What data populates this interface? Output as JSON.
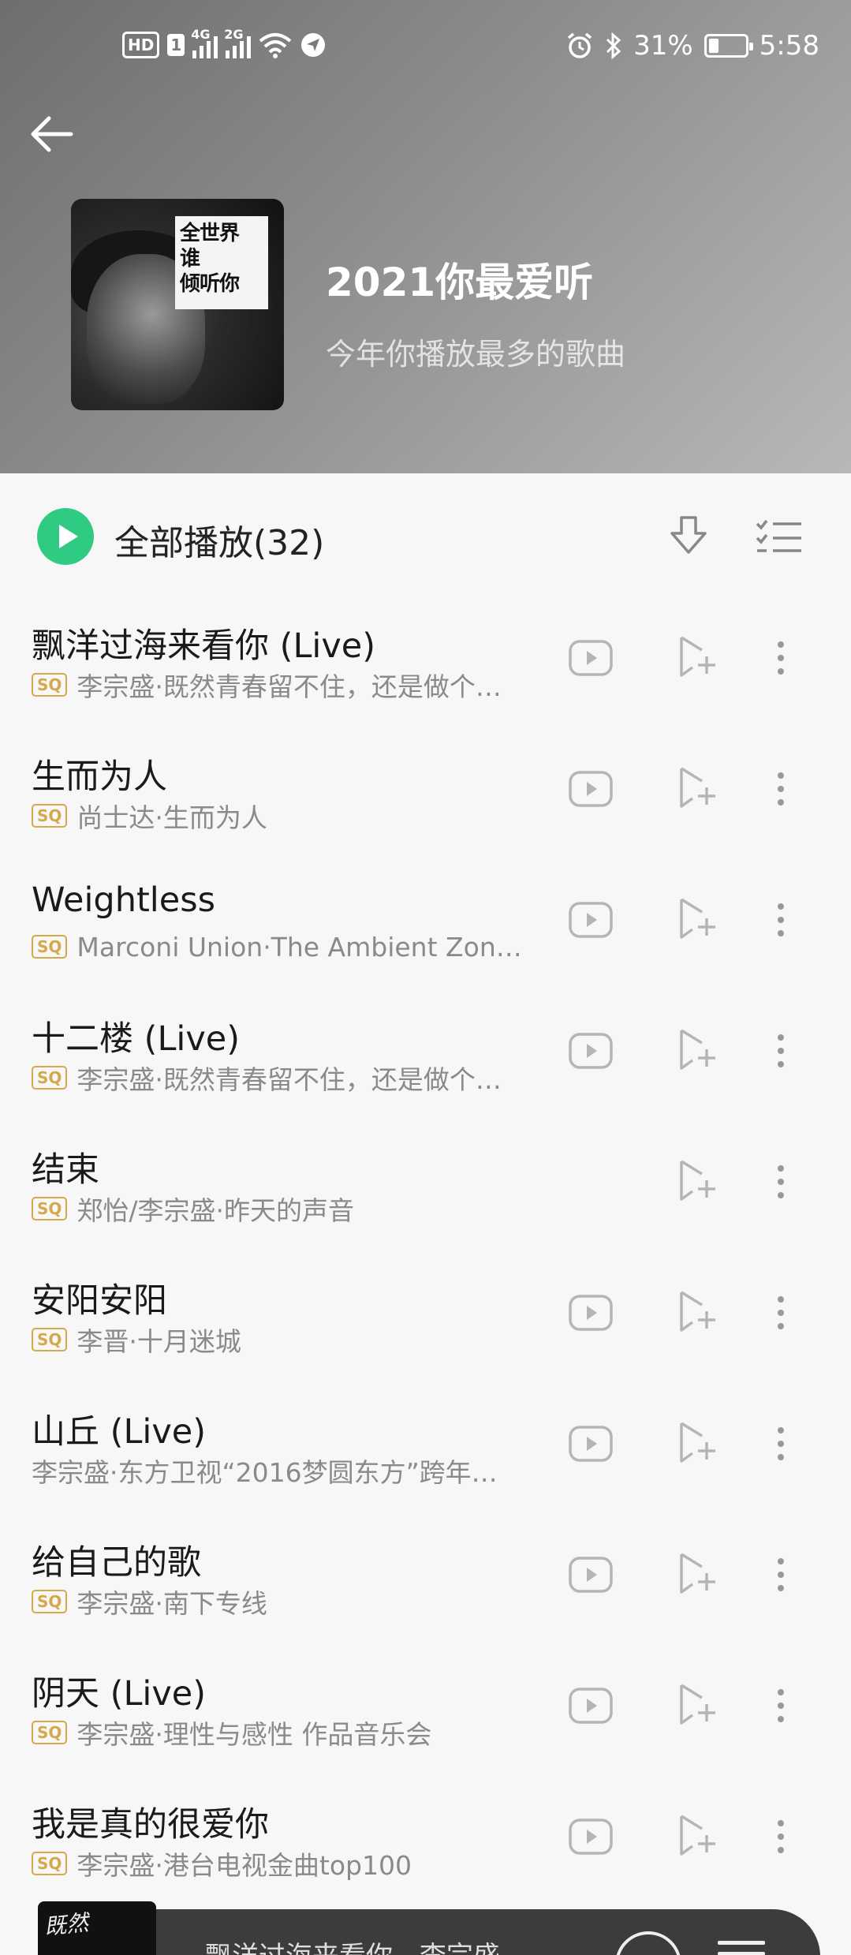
{
  "status_bar": {
    "hd_label": "HD",
    "sim_label": "1",
    "signal1_label": "4G",
    "signal2_label": "2G",
    "battery_percent": "31%",
    "time": "5:58"
  },
  "header": {
    "title": "2021你最爱听",
    "subtitle": "今年你播放最多的歌曲",
    "cover_text": [
      "全世界",
      "谁",
      "倾听你"
    ]
  },
  "toolbar": {
    "play_all_label": "全部播放(32)"
  },
  "songs": [
    {
      "title": "飘洋过海来看你 (Live)",
      "meta": "李宗盛·既然青春留不住，还是做个…",
      "sq": true,
      "has_mv": true
    },
    {
      "title": "生而为人",
      "meta": "尚士达·生而为人",
      "sq": true,
      "has_mv": true
    },
    {
      "title": "Weightless",
      "meta": "Marconi Union·The Ambient Zon…",
      "sq": true,
      "has_mv": true
    },
    {
      "title": "十二楼 (Live)",
      "meta": "李宗盛·既然青春留不住，还是做个…",
      "sq": true,
      "has_mv": true
    },
    {
      "title": "结束",
      "meta": "郑怡/李宗盛·昨天的声音",
      "sq": true,
      "has_mv": false
    },
    {
      "title": "安阳安阳",
      "meta": "李晋·十月迷城",
      "sq": true,
      "has_mv": true
    },
    {
      "title": "山丘 (Live)",
      "meta": "李宗盛·东方卫视“2016梦圆东方”跨年…",
      "sq": false,
      "has_mv": true
    },
    {
      "title": "给自己的歌",
      "meta": "李宗盛·南下专线",
      "sq": true,
      "has_mv": true
    },
    {
      "title": "阴天 (Live)",
      "meta": "李宗盛·理性与感性 作品音乐会",
      "sq": true,
      "has_mv": true
    },
    {
      "title": "我是真的很爱你",
      "meta": "李宗盛·港台电视金曲top100",
      "sq": true,
      "has_mv": true
    }
  ],
  "sq_badge": "SQ",
  "mini_player": {
    "text": "飘洋过海来看你 - 李宗盛"
  },
  "colors": {
    "accent": "#2fcb82",
    "sq_gold": "#d4a94a"
  }
}
